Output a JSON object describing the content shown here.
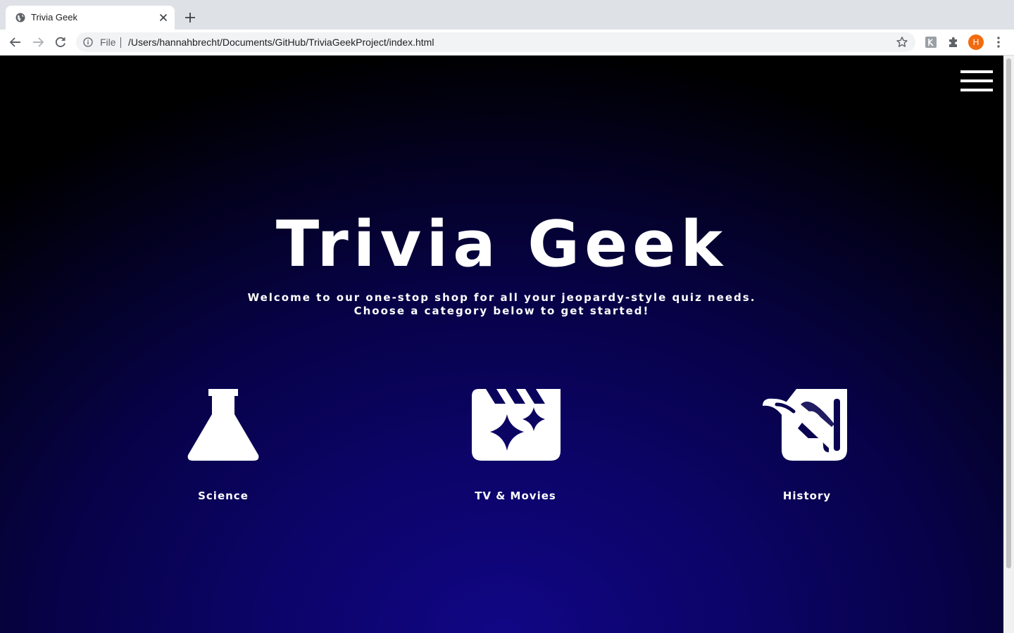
{
  "browser": {
    "tab_title": "Trivia Geek",
    "omnibox_scheme_label": "File",
    "url": "/Users/hannahbrecht/Documents/GitHub/TriviaGeekProject/index.html",
    "profile_initial": "H",
    "profile_color": "#f26b0f"
  },
  "page": {
    "title": "Trivia Geek",
    "intro_line1": "Welcome to our one-stop shop for all your jeopardy-style quiz needs.",
    "intro_line2": "Choose a category below to get started!",
    "categories": [
      {
        "label": "Science",
        "icon": "flask-icon"
      },
      {
        "label": "TV & Movies",
        "icon": "clapperboard-icon"
      },
      {
        "label": "History",
        "icon": "scroll-icon"
      }
    ],
    "menu_icon": "hamburger-menu-icon",
    "colors": {
      "background_top": "#000000",
      "background_glow": "#110685",
      "text": "#ffffff"
    }
  }
}
